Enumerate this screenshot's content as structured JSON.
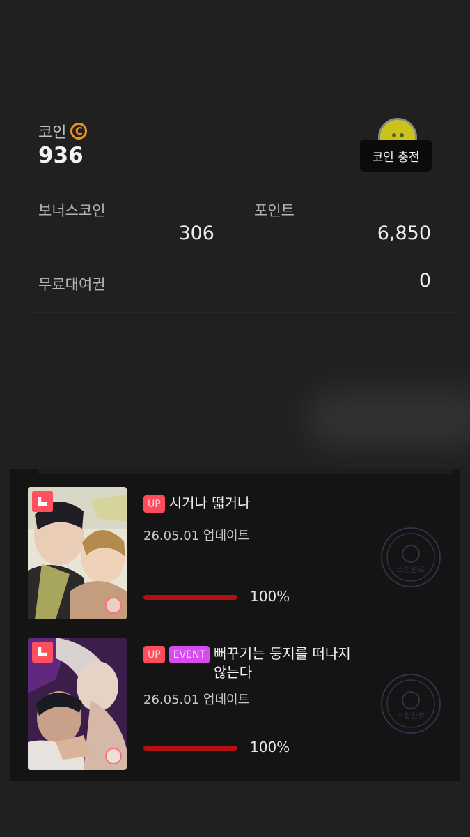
{
  "wallet": {
    "coin_label": "코인",
    "coin_icon": "copyright-coin-icon",
    "coin_value": "936",
    "charge_button_label": "코인 충전",
    "bonus_coin_label": "보너스코인",
    "bonus_coin_value": "306",
    "point_label": "포인트",
    "point_value": "6,850",
    "free_rental_label": "무료대여권",
    "free_rental_value": "0",
    "accent_color": "#f0921a"
  },
  "library": {
    "items": [
      {
        "tags": [
          "UP"
        ],
        "title": "시거나 떫거나",
        "updated": "26.05.01 업데이트",
        "progress": 1.0,
        "progress_text": "100%",
        "stamp_text": "소장완료"
      },
      {
        "tags": [
          "UP",
          "EVENT"
        ],
        "title": "뻐꾸기는 둥지를 떠나지 않는다",
        "updated": "26.05.01 업데이트",
        "progress": 1.0,
        "progress_text": "100%",
        "stamp_text": "소장완료"
      }
    ],
    "colors": {
      "up_tag": "#ff4c5c",
      "event_tag": "#d64cf0",
      "progress_fill": "#b51010"
    }
  }
}
